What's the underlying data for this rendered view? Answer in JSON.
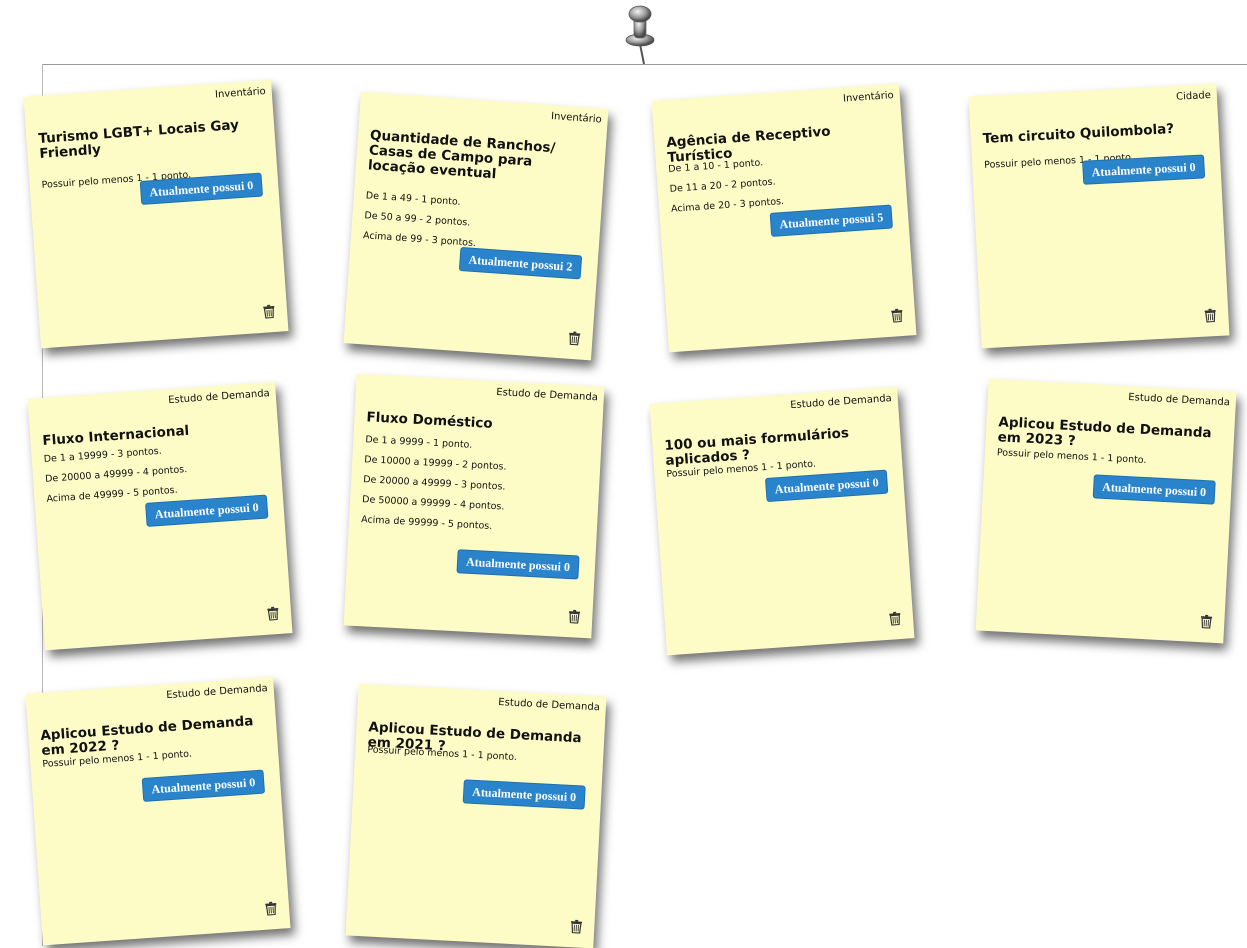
{
  "notes": [
    {
      "category": "Inventário",
      "title": "Turismo LGBT+ Locais Gay Friendly",
      "lines": [
        "Possuir pelo menos 1 - 1 ponto."
      ],
      "button": "Atualmente possui 0"
    },
    {
      "category": "Inventário",
      "title": "Quantidade de Ranchos/ Casas de Campo para locação eventual",
      "lines": [
        "De 1 a 49 - 1 ponto.",
        "De 50 a 99 - 2 pontos.",
        "Acima de 99 - 3 pontos."
      ],
      "button": "Atualmente possui 2"
    },
    {
      "category": "Inventário",
      "title": "Agência de Receptivo Turístico",
      "lines": [
        "De 1 a 10 - 1 ponto.",
        "De 11 a 20 - 2 pontos.",
        "Acima de 20 - 3 pontos."
      ],
      "button": "Atualmente possui 5"
    },
    {
      "category": "Cidade",
      "title": "Tem circuito Quilombola?",
      "lines": [
        "Possuir pelo menos 1 - 1 ponto."
      ],
      "button": "Atualmente possui 0"
    },
    {
      "category": "Estudo de Demanda",
      "title": "Fluxo Internacional",
      "lines": [
        "De 1 a 19999 - 3 pontos.",
        "De 20000 a 49999 - 4 pontos.",
        "Acima de 49999 - 5 pontos."
      ],
      "button": "Atualmente possui 0"
    },
    {
      "category": "Estudo de Demanda",
      "title": "Fluxo Doméstico",
      "lines": [
        "De 1 a 9999 - 1 ponto.",
        "De 10000 a 19999 - 2 pontos.",
        "De 20000 a 49999 - 3 pontos.",
        "De 50000 a 99999 - 4 pontos.",
        "Acima de 99999 - 5 pontos."
      ],
      "button": "Atualmente possui 0"
    },
    {
      "category": "Estudo de Demanda",
      "title": "100 ou mais formulários aplicados ?",
      "lines": [
        "Possuir pelo menos 1 - 1 ponto."
      ],
      "button": "Atualmente possui 0"
    },
    {
      "category": "Estudo de Demanda",
      "title": "Aplicou Estudo de Demanda em 2023 ?",
      "lines": [
        "Possuir pelo menos 1 - 1 ponto."
      ],
      "button": "Atualmente possui 0"
    },
    {
      "category": "Estudo de Demanda",
      "title": "Aplicou Estudo de Demanda em 2022 ?",
      "lines": [
        "Possuir pelo menos 1 - 1 ponto."
      ],
      "button": "Atualmente possui 0"
    },
    {
      "category": "Estudo de Demanda",
      "title": "Aplicou Estudo de Demanda em 2021 ?",
      "lines": [
        "Possuir pelo menos 1 - 1 ponto."
      ],
      "button": "Atualmente possui 0"
    }
  ],
  "icons": {
    "pin": "pushpin-icon",
    "delete": "trash-icon"
  },
  "colors": {
    "note_bg": "#fdfcc6",
    "button_bg": "#2a84cc",
    "title_bar": "#2a3f9c"
  }
}
